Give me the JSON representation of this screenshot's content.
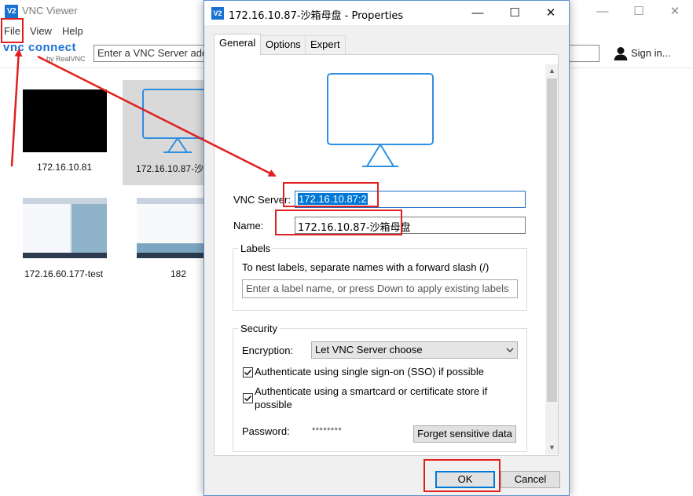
{
  "main_window": {
    "title": "VNC Viewer",
    "icon_text": "V2",
    "menu": [
      "File",
      "View",
      "Help"
    ],
    "logo": "vnc connect",
    "logo_sub": "by RealVNC",
    "search_placeholder": "Enter a VNC Server add",
    "sign_in": "Sign in...",
    "controls": {
      "minimize": "—",
      "maximize": "☐",
      "close": "✕"
    },
    "tiles": [
      {
        "label": "172.16.10.81"
      },
      {
        "label": "172.16.10.87-沙"
      },
      {
        "label": "172.16.60.177-test"
      },
      {
        "label": "182"
      }
    ]
  },
  "dialog": {
    "title": "172.16.10.87-沙箱母盘 - Properties",
    "icon_text": "V2",
    "controls": {
      "minimize": "—",
      "maximize": "☐",
      "close": "✕"
    },
    "tabs": [
      "General",
      "Options",
      "Expert"
    ],
    "active_tab": "General",
    "vnc_server_label": "VNC Server:",
    "vnc_server_value": "172.16.10.87:2",
    "name_label": "Name:",
    "name_value": "172.16.10.87-沙箱母盘",
    "labels_group": {
      "title": "Labels",
      "hint": "To nest labels, separate names with a forward slash (/)",
      "placeholder": "Enter a label name, or press Down to apply existing labels"
    },
    "security_group": {
      "title": "Security",
      "encryption_label": "Encryption:",
      "encryption_value": "Let VNC Server choose",
      "sso_label": "Authenticate using single sign-on (SSO) if possible",
      "sso_checked": true,
      "smartcard_label_line1": "Authenticate using a smartcard or certificate store if",
      "smartcard_label_line2": "possible",
      "smartcard_checked": true,
      "password_label": "Password:",
      "password_mask": "********",
      "forget_button": "Forget sensitive data"
    },
    "ok_button": "OK",
    "cancel_button": "Cancel"
  },
  "colors": {
    "accent": "#1b72d3",
    "monitor_blue": "#2f8fe0",
    "annotation_red": "#e02020",
    "selection": "#0078d7"
  }
}
